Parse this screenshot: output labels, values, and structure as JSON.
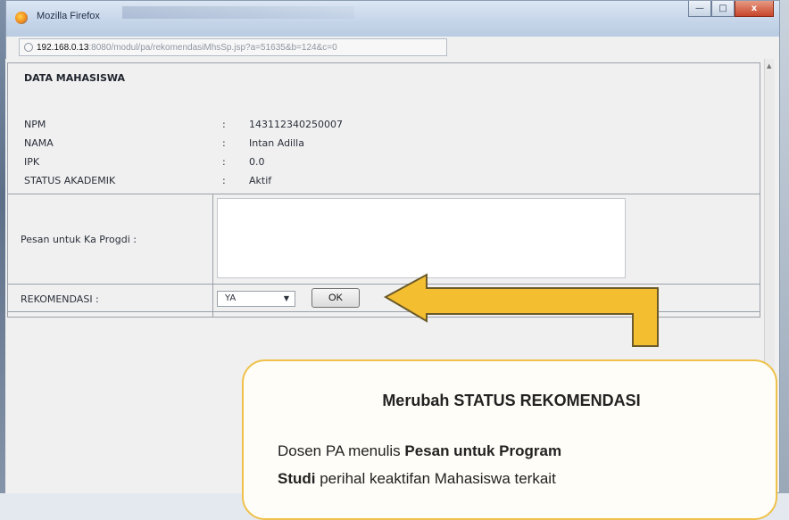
{
  "window": {
    "title": "Mozilla Firefox",
    "buttons": {
      "minimize": "—",
      "maximize": "□",
      "close": "x"
    }
  },
  "address": {
    "host": "192.168.0.13",
    "path": ":8080/modul/pa/rekomendasiMhsSp.jsp?a=51635&b=124&c=0"
  },
  "page": {
    "heading": "DATA MAHASISWA",
    "fields": [
      {
        "label": "NPM",
        "colon": ":",
        "value": "143112340250007"
      },
      {
        "label": "NAMA",
        "colon": ":",
        "value": "Intan Adilla"
      },
      {
        "label": "IPK",
        "colon": ":",
        "value": "0.0"
      },
      {
        "label": "STATUS AKADEMIK",
        "colon": ":",
        "value": "Aktif"
      }
    ],
    "pesan_label": "Pesan untuk Ka Progdi :",
    "pesan_value": "",
    "rekomendasi_label": "REKOMENDASI :",
    "rekomendasi_selected": "YA",
    "ok_label": "OK"
  },
  "callout": {
    "title": "Merubah STATUS REKOMENDASI",
    "body_prefix": "Dosen PA menulis ",
    "body_bold_1": "Pesan untuk Program",
    "body_bold_2": "Studi",
    "body_suffix": " perihal keaktifan Mahasiswa terkait"
  },
  "colors": {
    "arrow_fill": "#f3be2f",
    "arrow_stroke": "#6b5a2a",
    "callout_border": "#efc14a"
  }
}
